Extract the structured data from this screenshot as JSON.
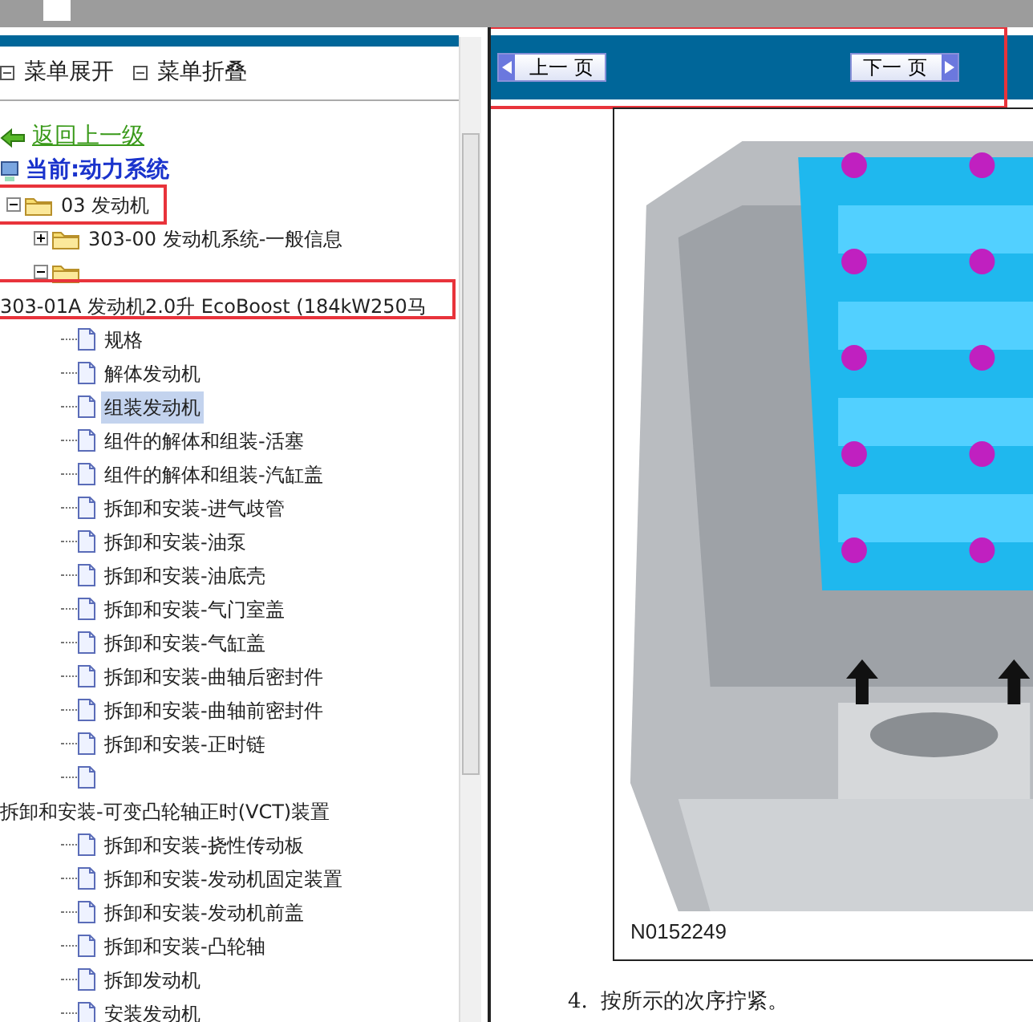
{
  "toolbar": [
    {
      "label": "菜单展开"
    },
    {
      "label": "菜单折叠"
    }
  ],
  "back_link": {
    "label": "返回上一级"
  },
  "current": {
    "label": "当前:动力系统"
  },
  "tree": [
    {
      "kind": "folder",
      "label": "03 发动机",
      "expanded": true,
      "boxed": true,
      "children": [
        {
          "kind": "folder",
          "label": "303-00 发动机系统-一般信息",
          "expanded": false
        },
        {
          "kind": "folder",
          "label": "303-01A 发动机2.0升 EcoBoost (184kW250马",
          "expanded": true,
          "label_below": true,
          "boxed": true,
          "children": [
            {
              "kind": "page",
              "label": "规格",
              "selected": false
            },
            {
              "kind": "page",
              "label": "解体发动机",
              "selected": false
            },
            {
              "kind": "page",
              "label": "组装发动机",
              "selected": true
            },
            {
              "kind": "page",
              "label": "组件的解体和组装-活塞",
              "selected": false
            },
            {
              "kind": "page",
              "label": "组件的解体和组装-汽缸盖",
              "selected": false
            },
            {
              "kind": "page",
              "label": "拆卸和安装-进气歧管",
              "selected": false
            },
            {
              "kind": "page",
              "label": "拆卸和安装-油泵",
              "selected": false
            },
            {
              "kind": "page",
              "label": "拆卸和安装-油底壳",
              "selected": false
            },
            {
              "kind": "page",
              "label": "拆卸和安装-气门室盖",
              "selected": false
            },
            {
              "kind": "page",
              "label": "拆卸和安装-气缸盖",
              "selected": false
            },
            {
              "kind": "page",
              "label": "拆卸和安装-曲轴后密封件",
              "selected": false
            },
            {
              "kind": "page",
              "label": "拆卸和安装-曲轴前密封件",
              "selected": false
            },
            {
              "kind": "page",
              "label": "拆卸和安装-正时链",
              "selected": false
            },
            {
              "kind": "page",
              "label": "拆卸和安装-可变凸轮轴正时(VCT)装置",
              "selected": false,
              "label_below": true
            },
            {
              "kind": "page",
              "label": "拆卸和安装-挠性传动板",
              "selected": false
            },
            {
              "kind": "page",
              "label": "拆卸和安装-发动机固定装置",
              "selected": false
            },
            {
              "kind": "page",
              "label": "拆卸和安装-发动机前盖",
              "selected": false
            },
            {
              "kind": "page",
              "label": "拆卸和安装-凸轮轴",
              "selected": false
            },
            {
              "kind": "page",
              "label": "拆卸发动机",
              "selected": false
            },
            {
              "kind": "page",
              "label": "安装发动机",
              "selected": false
            }
          ]
        }
      ]
    }
  ],
  "nav": {
    "boxed": true,
    "buttons": [
      {
        "kind": "prev",
        "label": "上一 页"
      },
      {
        "kind": "next",
        "label": "下一 页"
      }
    ]
  },
  "figure": {
    "kind": "picture",
    "caption": "N0152249"
  },
  "steps": [
    {
      "number": "4.",
      "text": "按所示的次序拧紧。"
    }
  ]
}
